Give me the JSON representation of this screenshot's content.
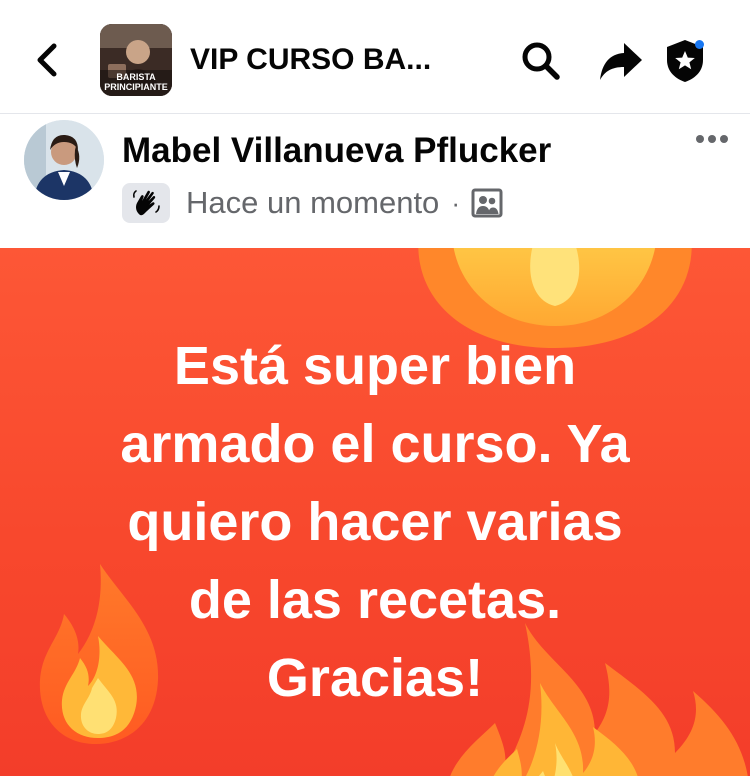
{
  "header": {
    "group_title": "VIP CURSO BA...",
    "thumbnail": {
      "label_line1": "BARISTA",
      "label_line2": "PRINCIPIANTE"
    },
    "icons": [
      "back-icon",
      "search-icon",
      "share-icon",
      "shield-icon"
    ],
    "notification_dot_color": "#1877f2"
  },
  "post": {
    "author": "Mabel Villanueva Pflucker",
    "timestamp": "Hace un momento",
    "separator": "·",
    "badge_icon": "wave-hand-icon",
    "audience_icon": "group-audience-icon",
    "more_icon": "more-dots-icon",
    "text": "Está super bien\narmado el curso. Ya\nquiero hacer varias\nde las recetas.\nGracias!",
    "background": {
      "color": "#fa4a2f",
      "decoration": "flame-emoji-icon"
    }
  }
}
